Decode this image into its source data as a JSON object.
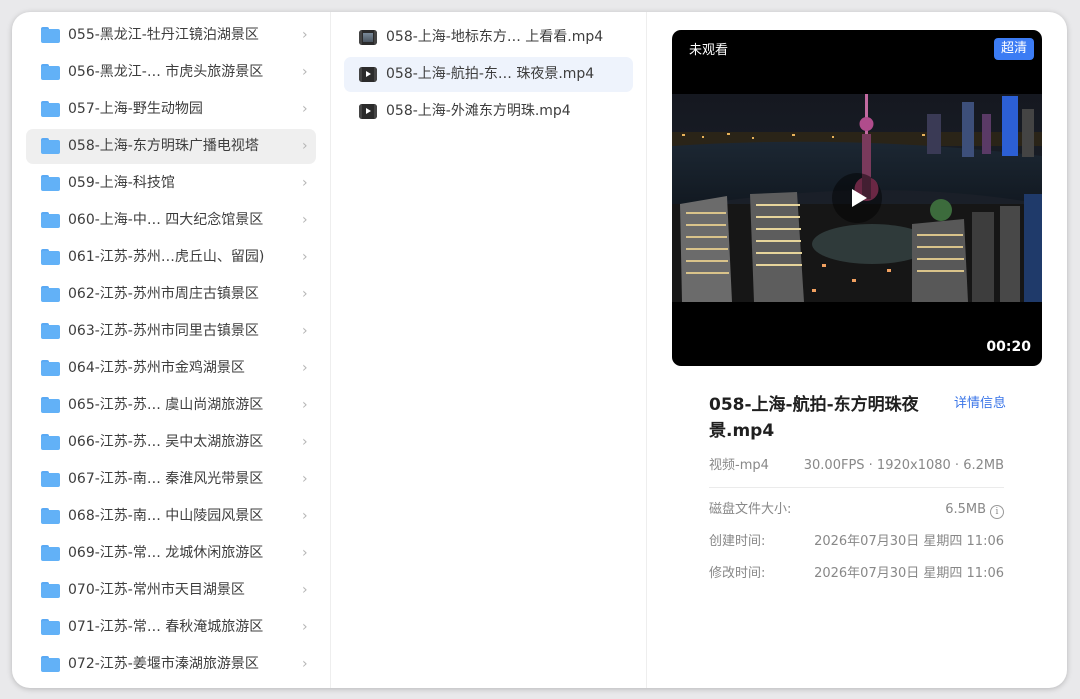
{
  "folders": [
    {
      "label": "055-黑龙江-牡丹江镜泊湖景区"
    },
    {
      "label": "056-黑龙江-… 市虎头旅游景区"
    },
    {
      "label": "057-上海-野生动物园"
    },
    {
      "label": "058-上海-东方明珠广播电视塔"
    },
    {
      "label": "059-上海-科技馆"
    },
    {
      "label": "060-上海-中… 四大纪念馆景区"
    },
    {
      "label": "061-江苏-苏州…虎丘山、留园)"
    },
    {
      "label": "062-江苏-苏州市周庄古镇景区"
    },
    {
      "label": "063-江苏-苏州市同里古镇景区"
    },
    {
      "label": "064-江苏-苏州市金鸡湖景区"
    },
    {
      "label": "065-江苏-苏… 虞山尚湖旅游区"
    },
    {
      "label": "066-江苏-苏… 吴中太湖旅游区"
    },
    {
      "label": "067-江苏-南… 秦淮风光带景区"
    },
    {
      "label": "068-江苏-南… 中山陵园风景区"
    },
    {
      "label": "069-江苏-常… 龙城休闲旅游区"
    },
    {
      "label": "070-江苏-常州市天目湖景区"
    },
    {
      "label": "071-江苏-常… 春秋淹城旅游区"
    },
    {
      "label": "072-江苏-姜堰市溱湖旅游景区"
    }
  ],
  "chevron": "›",
  "files": [
    {
      "label": "058-上海-地标东方… 上看看.mp4"
    },
    {
      "label": "058-上海-航拍-东…  珠夜景.mp4"
    },
    {
      "label": "058-上海-外滩东方明珠.mp4"
    }
  ],
  "preview": {
    "status": "未观看",
    "quality": "超清",
    "duration": "00:20",
    "title": "058-上海-航拍-东方明珠夜景.mp4",
    "details_link": "详情信息",
    "type": "视频-mp4",
    "spec": "30.00FPS · 1920x1080 · 6.2MB",
    "info": [
      {
        "label": "磁盘文件大小:",
        "value": "6.5MB"
      },
      {
        "label": "创建时间:",
        "value": "2026年07月30日 星期四 11:06"
      },
      {
        "label": "修改时间:",
        "value": "2026年07月30日 星期四 11:06"
      }
    ],
    "info_icon": "i"
  },
  "colors": {
    "accent": "#3c7cf4",
    "folder": "#62b1f7",
    "selected_folder_bg": "#efefef",
    "selected_file_bg": "#eef3fc"
  }
}
